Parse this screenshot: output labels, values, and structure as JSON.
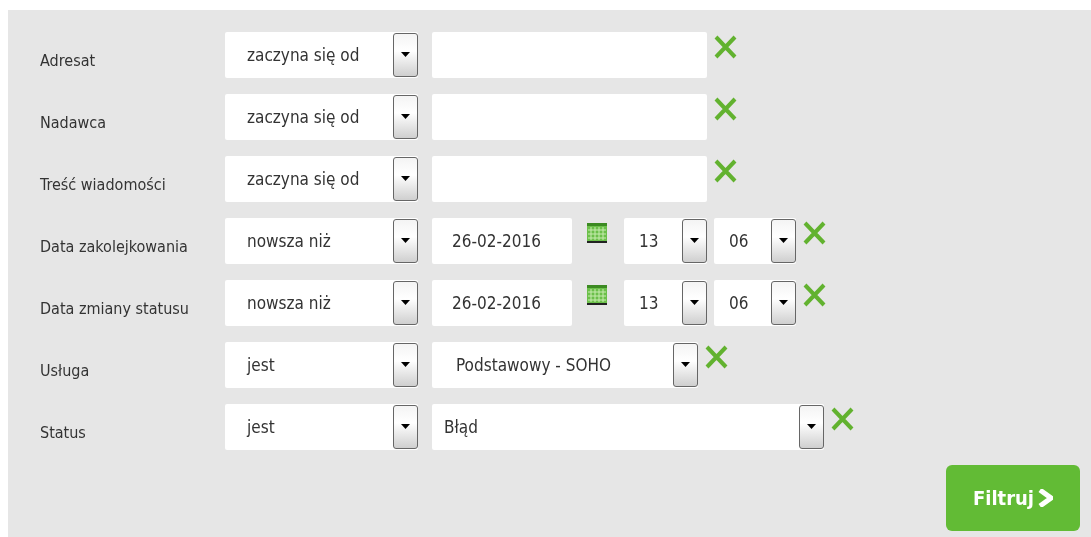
{
  "filters": [
    {
      "kind": "text",
      "label": "Adresat",
      "operator": "zaczyna się od"
    },
    {
      "kind": "text",
      "label": "Nadawca",
      "operator": "zaczyna się od"
    },
    {
      "kind": "text",
      "label": "Treść wiadomości",
      "operator": "zaczyna się od"
    },
    {
      "kind": "datetime",
      "label": "Data zakolejkowania",
      "operator": "nowsza niż",
      "date": "26-02-2016",
      "hour": "13",
      "minute": "06"
    },
    {
      "kind": "datetime",
      "label": "Data zmiany statusu",
      "operator": "nowsza niż",
      "date": "26-02-2016",
      "hour": "13",
      "minute": "06"
    },
    {
      "kind": "select",
      "label": "Usługa",
      "operator": "jest",
      "value": "Podstawowy - SOHO"
    },
    {
      "kind": "wide-select",
      "label": "Status",
      "operator": "jest",
      "value": "Błąd"
    }
  ],
  "submit": {
    "label": "Filtruj"
  }
}
